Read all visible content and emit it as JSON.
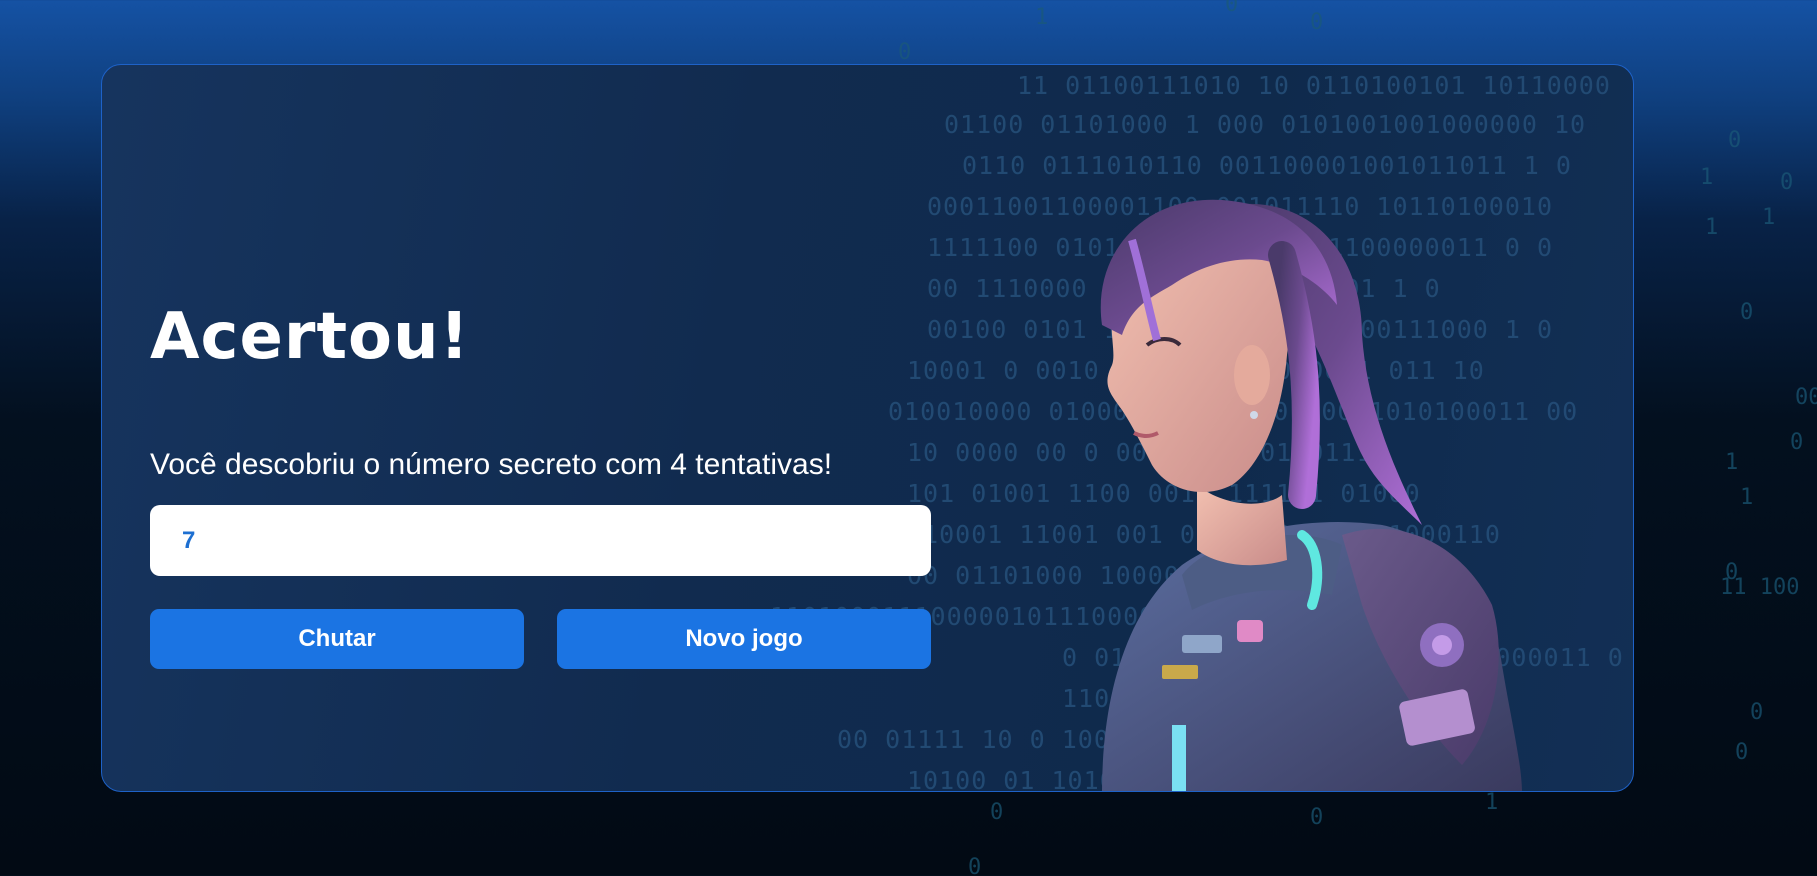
{
  "game": {
    "title": "Acertou!",
    "message": "Você descobriu o número secreto com 4 tentativas!",
    "input_value": "7",
    "guess_button": "Chutar",
    "new_game_button": "Novo jogo"
  },
  "theme": {
    "accent": "#1b74e3",
    "card_border": "#1e62c8",
    "input_text": "#1d6fd1"
  },
  "illustration": {
    "icon": "cyber-girl-avatar",
    "hair_color": "#9b59d6",
    "suit_color": "#4b5f8a",
    "glow_color": "#5fe8e0"
  }
}
